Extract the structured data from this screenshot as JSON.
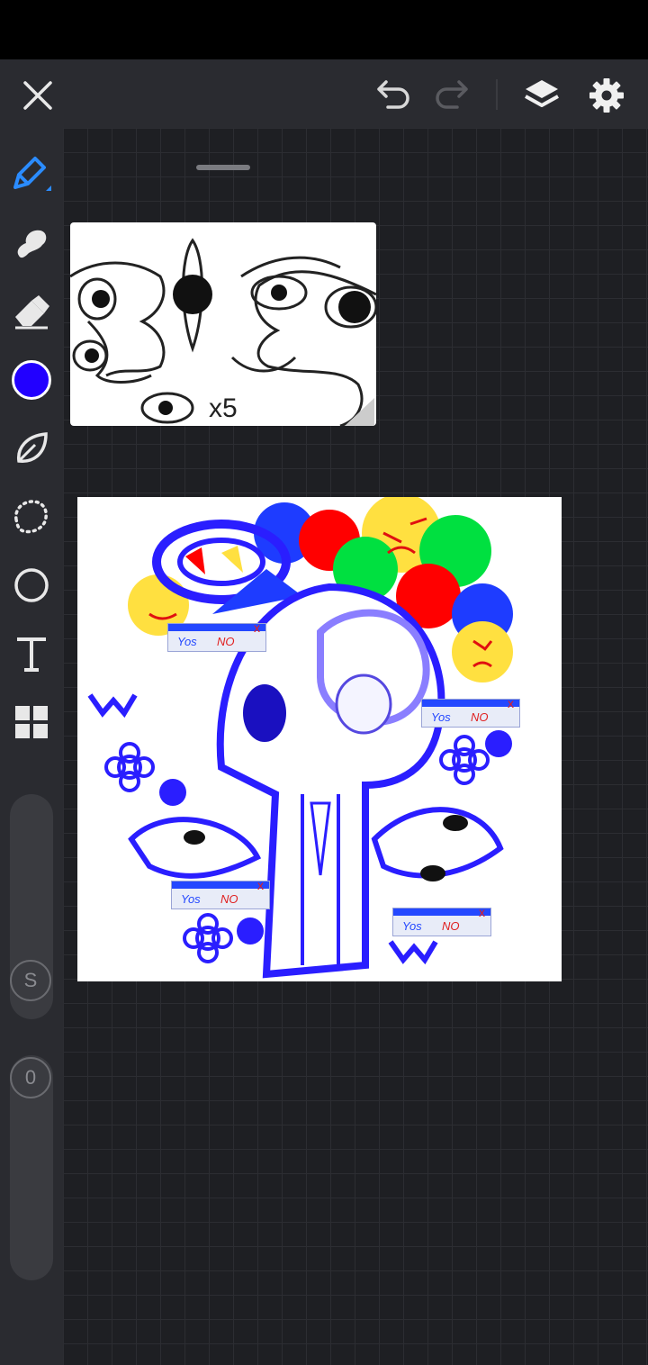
{
  "toolbar": {
    "close": "close-icon",
    "undo": "undo-icon",
    "redo": "redo-icon",
    "layers": "layers-icon",
    "settings": "gear-icon"
  },
  "tools": [
    {
      "name": "pen",
      "icon": "pen-icon",
      "active": true
    },
    {
      "name": "smudge",
      "icon": "smudge-icon"
    },
    {
      "name": "eraser",
      "icon": "eraser-icon"
    },
    {
      "name": "color",
      "icon": "color-swatch",
      "value": "#2200ff"
    },
    {
      "name": "fill",
      "icon": "leaf-icon"
    },
    {
      "name": "lasso",
      "icon": "lasso-icon"
    },
    {
      "name": "shape",
      "icon": "circle-icon"
    },
    {
      "name": "text",
      "icon": "text-icon"
    },
    {
      "name": "more",
      "icon": "grid-icon"
    }
  ],
  "sliders": {
    "size_label": "S",
    "opacity_label": "0"
  },
  "artwork": {
    "dialogs": [
      {
        "yes": "Yos",
        "no": "NO",
        "close": "x"
      },
      {
        "yes": "Yos",
        "no": "NO",
        "close": "x"
      },
      {
        "yes": "Yos",
        "no": "NO",
        "close": "x"
      },
      {
        "yes": "Yos",
        "no": "NO",
        "close": "x"
      }
    ]
  },
  "reference": {
    "caption": "x5"
  },
  "colors": {
    "accent": "#2b8cff",
    "toolbar_bg": "#2a2b30",
    "canvas_bg": "#1e1f23",
    "brush": "#2200ff"
  }
}
